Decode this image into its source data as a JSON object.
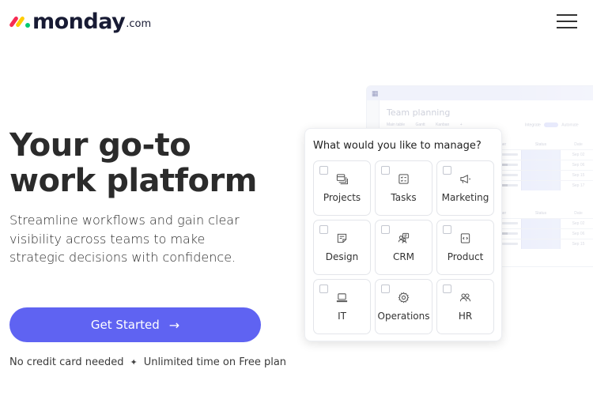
{
  "header": {
    "logo_word": "monday",
    "logo_suffix": ".com",
    "logo_colors": {
      "red": "#f62b54",
      "yellow": "#ffcc00",
      "green": "#00ca72"
    },
    "menu_icon": "hamburger-menu-icon"
  },
  "hero": {
    "title_line1": "Your go-to",
    "title_line2": "work platform",
    "subtitle": "Streamline workflows and gain clear visibility across teams to make strategic decisions with confidence.",
    "cta_label": "Get Started",
    "cta_icon": "arrow-right-icon",
    "cta_color": "#5f63f2",
    "note_left": "No credit card needed",
    "note_separator": "✦",
    "note_right": "Unlimited time on Free plan"
  },
  "board_preview": {
    "title": "Team planning",
    "tabs": [
      "Main table",
      "Gantt",
      "Kanban",
      "+"
    ],
    "tools": [
      "Integrate",
      "Automate"
    ],
    "table_headers": [
      "ner",
      "Status",
      "Date"
    ],
    "group1_dates": [
      "Sep 02",
      "Sep 06",
      "Sep 15",
      "Sep 17"
    ],
    "group2_dates": [
      "Sep 02",
      "Sep 06",
      "Sep 15"
    ]
  },
  "picker": {
    "title": "What would you like to manage?",
    "options": [
      {
        "label": "Projects",
        "icon": "projects-icon",
        "checked": false
      },
      {
        "label": "Tasks",
        "icon": "tasks-icon",
        "checked": false
      },
      {
        "label": "Marketing",
        "icon": "megaphone-icon",
        "checked": false
      },
      {
        "label": "Design",
        "icon": "design-icon",
        "checked": false
      },
      {
        "label": "CRM",
        "icon": "crm-icon",
        "checked": false
      },
      {
        "label": "Product",
        "icon": "product-code-icon",
        "checked": false
      },
      {
        "label": "IT",
        "icon": "laptop-icon",
        "checked": false
      },
      {
        "label": "Operations",
        "icon": "gear-icon",
        "checked": false
      },
      {
        "label": "HR",
        "icon": "people-icon",
        "checked": false
      }
    ]
  }
}
